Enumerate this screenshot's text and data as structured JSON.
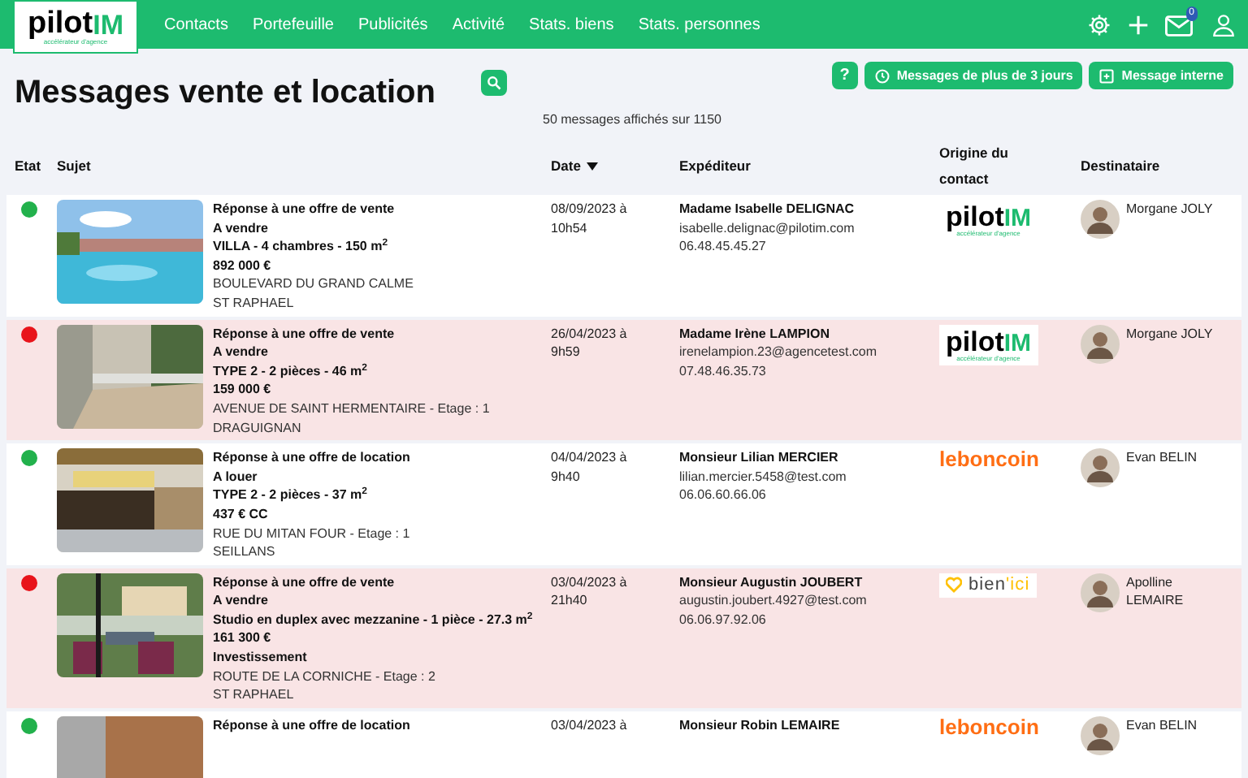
{
  "nav": {
    "logo": {
      "brand": "pilot",
      "brand_accent": "IM",
      "tagline": "accélérateur d'agence"
    },
    "links": [
      "Contacts",
      "Portefeuille",
      "Publicités",
      "Activité",
      "Stats. biens",
      "Stats. personnes"
    ],
    "mail_badge": "0"
  },
  "header": {
    "title": "Messages vente et location",
    "help": "?",
    "buttons": [
      "Messages de plus de 3 jours",
      "Message interne"
    ],
    "count": "50 messages affichés sur 1150"
  },
  "table": {
    "columns": [
      {
        "label": "Etat",
        "sorted": false
      },
      {
        "label": "Sujet",
        "sorted": false
      },
      {
        "label": "Date",
        "sorted": true
      },
      {
        "label": "Expéditeur",
        "sorted": false
      },
      {
        "label": "Origine du contact",
        "sorted": false
      },
      {
        "label": "Destinataire",
        "sorted": false
      }
    ],
    "rows": [
      {
        "color": "#22b14c",
        "highlighted": false,
        "subject": [
          {
            "text": "Réponse à une offre de vente",
            "bold": true
          },
          {
            "text": "A vendre",
            "bold": true
          },
          {
            "text": "VILLA - 4 chambres - 150 m$^{2}$",
            "bold": true
          },
          {
            "text": "892 000 €",
            "bold": true
          },
          {
            "text": "BOULEVARD DU GRAND CALME",
            "bold": false
          },
          {
            "text": "ST RAPHAEL",
            "bold": false
          }
        ],
        "date": [
          "08/09/2023 à",
          "10h54"
        ],
        "sender": [
          "Madame Isabelle DELIGNAC",
          "isabelle.delignac@pilotim.com",
          "06.48.45.45.27"
        ],
        "origin": {
          "kind": "pilotim",
          "text": "pilot",
          "accent": "IM",
          "tagline": "accélérateur d'agence"
        },
        "recipient": "Morgane JOLY"
      },
      {
        "color": "#e8141b",
        "highlighted": true,
        "subject": [
          {
            "text": "Réponse à une offre de vente",
            "bold": true
          },
          {
            "text": "A vendre",
            "bold": true
          },
          {
            "text": "TYPE 2 - 2 pièces - 46 m$^{2}$",
            "bold": true
          },
          {
            "text": "159 000 €",
            "bold": true
          },
          {
            "text": "AVENUE DE SAINT HERMENTAIRE - Etage : 1",
            "bold": false
          },
          {
            "text": "DRAGUIGNAN",
            "bold": false
          }
        ],
        "date": [
          "26/04/2023 à",
          "9h59"
        ],
        "sender": [
          "Madame Irène LAMPION",
          "irenelampion.23@agencetest.com",
          "07.48.46.35.73"
        ],
        "origin": {
          "kind": "pilotim",
          "text": "pilot",
          "accent": "IM",
          "tagline": "accélérateur d'agence"
        },
        "recipient": "Morgane JOLY"
      },
      {
        "color": "#22b14c",
        "highlighted": false,
        "subject": [
          {
            "text": "Réponse à une offre de location",
            "bold": true
          },
          {
            "text": "A louer",
            "bold": true
          },
          {
            "text": "TYPE 2 - 2 pièces - 37 m$^{2}$",
            "bold": true
          },
          {
            "text": "437 € CC",
            "bold": true
          },
          {
            "text": "RUE DU MITAN FOUR - Etage : 1",
            "bold": false
          },
          {
            "text": "SEILLANS",
            "bold": false
          }
        ],
        "date": [
          "04/04/2023 à",
          "9h40"
        ],
        "sender": [
          "Monsieur Lilian MERCIER",
          "lilian.mercier.5458@test.com",
          "06.06.60.66.06"
        ],
        "origin": {
          "kind": "leboncoin",
          "text": "leboncoin"
        },
        "recipient": "Evan BELIN"
      },
      {
        "color": "#e8141b",
        "highlighted": true,
        "subject": [
          {
            "text": "Réponse à une offre de vente",
            "bold": true
          },
          {
            "text": "A vendre",
            "bold": true
          },
          {
            "text": "Studio en duplex avec mezzanine - 1 pièce - 27.3 m$^{2}$",
            "bold": true
          },
          {
            "text": "161 300 €",
            "bold": true
          },
          {
            "text": "Investissement",
            "bold": true
          },
          {
            "text": "ROUTE DE LA CORNICHE - Etage : 2",
            "bold": false
          },
          {
            "text": "ST RAPHAEL",
            "bold": false
          }
        ],
        "date": [
          "03/04/2023 à",
          "21h40"
        ],
        "sender": [
          "Monsieur Augustin JOUBERT",
          "augustin.joubert.4927@test.com",
          "06.06.97.92.06"
        ],
        "origin": {
          "kind": "bienici",
          "text": "bien",
          "accent": "'ici"
        },
        "recipient": "Apolline LEMAIRE"
      },
      {
        "color": "#22b14c",
        "highlighted": false,
        "subject": [
          {
            "text": "Réponse à une offre de location",
            "bold": true
          }
        ],
        "date": [
          "03/04/2023 à"
        ],
        "sender": [
          "Monsieur Robin LEMAIRE"
        ],
        "origin": {
          "kind": "leboncoin",
          "text": "leboncoin"
        },
        "recipient": "Evan BELIN"
      }
    ]
  }
}
